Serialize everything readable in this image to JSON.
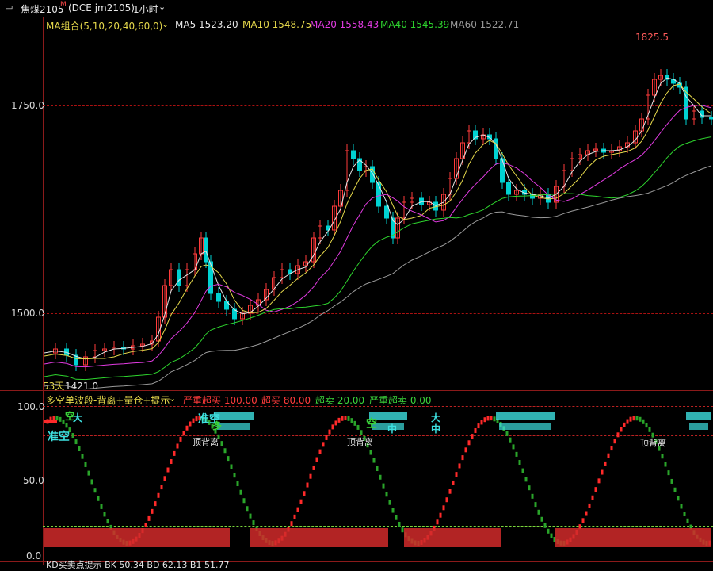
{
  "window": {
    "menu_icon": "menu-icon",
    "symbol": "焦煤2105",
    "superscript": "M",
    "contract": "(DCE jm2105)",
    "period": "1小时",
    "period_dropdown_icon": "chevron-down-icon"
  },
  "ma_legend": {
    "group": "MA组合(5,10,20,40,60,0)",
    "items": [
      {
        "label": "MA5 1523.20",
        "color": "#e6e6e6"
      },
      {
        "label": "MA10 1548.75",
        "color": "#e5d84b"
      },
      {
        "label": "MA20 1558.43",
        "color": "#e23be2"
      },
      {
        "label": "MA40 1545.39",
        "color": "#2ed52e"
      },
      {
        "label": "MA60 1522.71",
        "color": "#9a9a9a"
      }
    ]
  },
  "price_axis": {
    "labels": [
      "1750.0",
      "1500.0"
    ]
  },
  "price_annotations": {
    "high": "1825.5",
    "low_days": "53天",
    "low": "1421.0"
  },
  "indicator": {
    "name": "多空单波段-背离+量仓+提示",
    "levels": [
      {
        "label": "严重超买 100.00",
        "color": "#ff3b3b"
      },
      {
        "label": "超买 80.00",
        "color": "#ff3b3b"
      },
      {
        "label": "超卖 20.00",
        "color": "#3bd43b"
      },
      {
        "label": "严重超卖 0.00",
        "color": "#3bd43b"
      }
    ],
    "axis_labels": [
      "100.0",
      "50.0",
      "0.0"
    ],
    "signals": {
      "zhun_kong": "准空",
      "zhun_kong_2": "准空",
      "kong": "空",
      "kong_2": "空",
      "duo": "多",
      "da": "大",
      "zhong": "中",
      "zhong_2": "中",
      "da_2": "大",
      "zhong_3": "中",
      "top_divergence": "顶背离"
    }
  },
  "bottom_panel": {
    "text": "KD买卖点提示   BK 50.34  BD 62.13  B1 51.77"
  },
  "colors": {
    "up": "#ff3b3b",
    "down": "#00d2d2",
    "green_bar": "#2aa52a",
    "red_bar": "#ff2a2a"
  }
}
